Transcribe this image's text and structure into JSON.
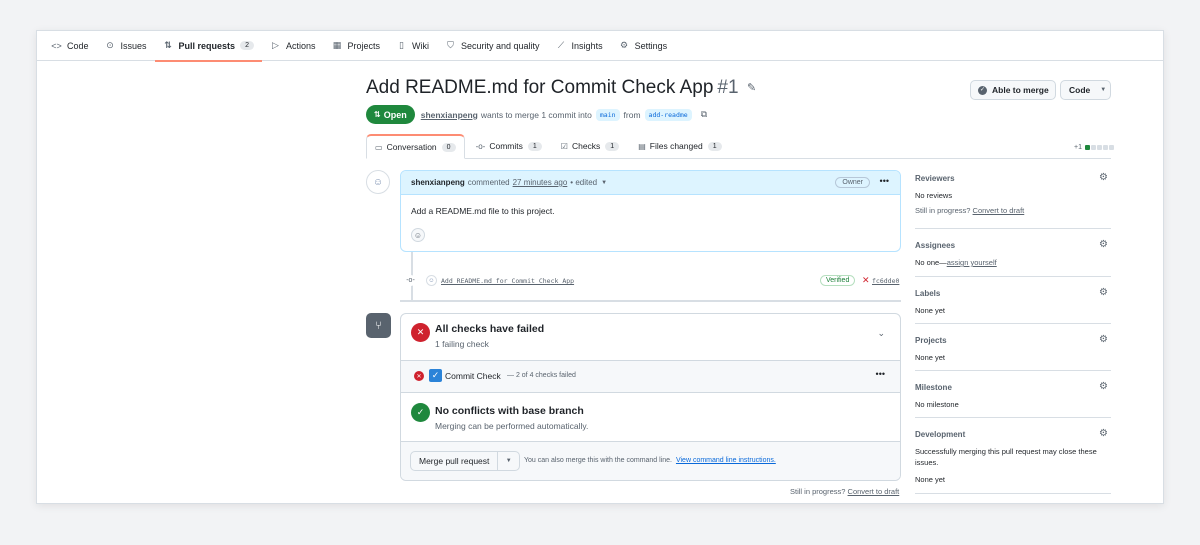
{
  "repo_nav": {
    "items": [
      {
        "icon": "code-icon",
        "glyph": "<>",
        "label": "Code"
      },
      {
        "icon": "issue-icon",
        "glyph": "⊙",
        "label": "Issues"
      },
      {
        "icon": "pull-request-icon",
        "glyph": "⇅",
        "label": "Pull requests",
        "count": "2",
        "active": true
      },
      {
        "icon": "play-icon",
        "glyph": "▷",
        "label": "Actions"
      },
      {
        "icon": "table-icon",
        "glyph": "▦",
        "label": "Projects"
      },
      {
        "icon": "book-icon",
        "glyph": "▯",
        "label": "Wiki"
      },
      {
        "icon": "shield-icon",
        "glyph": "⛉",
        "label": "Security and quality"
      },
      {
        "icon": "graph-icon",
        "glyph": "⟋",
        "label": "Insights"
      },
      {
        "icon": "gear-icon",
        "glyph": "⚙",
        "label": "Settings"
      }
    ]
  },
  "pr": {
    "title": "Add README.md for Commit Check App",
    "number": "#1",
    "status": "Open",
    "author": "shenxianpeng",
    "wants_text": "wants to merge 1 commit into",
    "base_branch": "main",
    "from_text": "from",
    "head_branch": "add-readme"
  },
  "header_buttons": {
    "merge_status": "Able to merge",
    "code": "Code"
  },
  "tabs": [
    {
      "icon": "comment-icon",
      "glyph": "▭",
      "label": "Conversation",
      "count": "0",
      "active": true
    },
    {
      "icon": "commit-icon",
      "glyph": "-o-",
      "label": "Commits",
      "count": "1"
    },
    {
      "icon": "checklist-icon",
      "glyph": "☑",
      "label": "Checks",
      "count": "1"
    },
    {
      "icon": "file-diff-icon",
      "glyph": "▤",
      "label": "Files changed",
      "count": "1"
    }
  ],
  "diffstat": {
    "text": "+1"
  },
  "comment": {
    "author": "shenxianpeng",
    "action": "commented",
    "time": "27 minutes ago",
    "edited": "• edited",
    "badge": "Owner",
    "body": "Add a README.md file to this project."
  },
  "commit": {
    "message": "Add README.md for Commit Check App",
    "verified": "Verified",
    "sha": "fc6dde0"
  },
  "merge_box": {
    "checks_title": "All checks have failed",
    "checks_sub": "1 failing check",
    "check_name": "Commit Check",
    "check_summary": "— 2 of 4 checks failed",
    "conflicts_title": "No conflicts with base branch",
    "conflicts_sub": "Merging can be performed automatically.",
    "merge_button": "Merge pull request",
    "merge_note": "You can also merge this with the command line.",
    "merge_note_link": "View command line instructions."
  },
  "footer": {
    "still_in_progress": "Still in progress?",
    "convert_to_draft": "Convert to draft"
  },
  "sidebar": {
    "reviewers": {
      "title": "Reviewers",
      "value": "No reviews",
      "note": "Still in progress?",
      "note_link": "Convert to draft"
    },
    "assignees": {
      "title": "Assignees",
      "value": "No one—",
      "link": "assign yourself"
    },
    "labels": {
      "title": "Labels",
      "value": "None yet"
    },
    "projects": {
      "title": "Projects",
      "value": "None yet"
    },
    "milestone": {
      "title": "Milestone",
      "value": "No milestone"
    },
    "development": {
      "title": "Development",
      "value": "Successfully merging this pull request may close these issues.",
      "value2": "None yet"
    }
  },
  "colors": {
    "open_green": "#1f883d",
    "fail_red": "#cf222e",
    "accent_orange": "#fd8c73",
    "link_blue": "#0969da"
  }
}
